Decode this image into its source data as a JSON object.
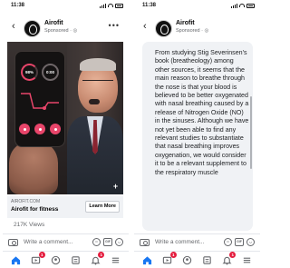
{
  "status_bar": {
    "time": "11:38"
  },
  "post": {
    "page_name": "Airofit",
    "sponsored": "Sponsored · ",
    "globe_icon": "globe-icon",
    "more_icon": "more-dots-icon"
  },
  "video": {
    "ring_left": "98%",
    "ring_right": "0:00",
    "expand_icon": "plus-icon"
  },
  "link": {
    "domain": "AIROFIT.COM",
    "title": "Airofit for fitness",
    "cta": "Learn More"
  },
  "views": "217K Views",
  "caption": "From studying Stig Severinsen's book (breatheology) among other sources, it seems that the main reason to breathe through the nose is that your blood is believed to be better oxygenated with nasal breathing caused by a release of Nitrogen Oxide (NO) in the sinuses. Although we have not yet been able to find any relevant studies to substantiate that nasal breathing improves oxygenation, we would consider it to be a relevant supplement to the respiratory muscle",
  "comment_bar": {
    "placeholder": "Write a comment...",
    "gif": "GIF"
  },
  "tab_bar": {
    "tabs": [
      "home",
      "video",
      "groups",
      "marketplace",
      "notifications",
      "menu"
    ],
    "notification_badge": "1",
    "video_badge": "1"
  },
  "colors": {
    "accent": "#1877f2",
    "badge": "#e41e3f",
    "pink": "#e8456a"
  }
}
